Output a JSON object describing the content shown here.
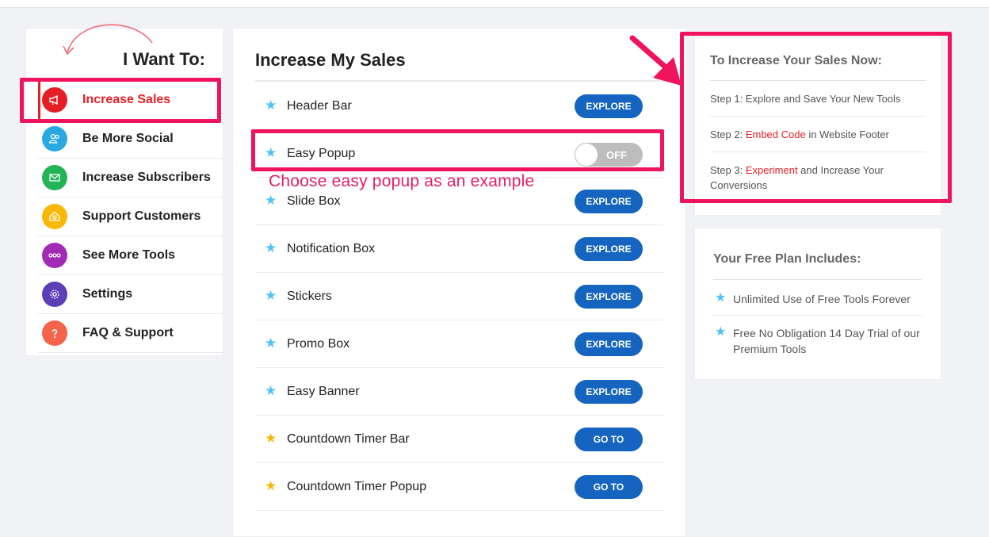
{
  "sidebar": {
    "title": "I Want To:",
    "items": [
      {
        "label": "Increase Sales",
        "icon": "megaphone-icon",
        "color": "#e51e25",
        "glyph": "✆"
      },
      {
        "label": "Be More Social",
        "icon": "users-icon",
        "color": "#29a9e1",
        "glyph": "☺"
      },
      {
        "label": "Increase Subscribers",
        "icon": "envelope-icon",
        "color": "#22b557",
        "glyph": "✉"
      },
      {
        "label": "Support Customers",
        "icon": "support-icon",
        "color": "#f9b708",
        "glyph": "⌂"
      },
      {
        "label": "See More Tools",
        "icon": "more-icon",
        "color": "#a12bb5",
        "glyph": "∞"
      },
      {
        "label": "Settings",
        "icon": "gear-icon",
        "color": "#5c3fb6",
        "glyph": "⚙"
      },
      {
        "label": "FAQ & Support",
        "icon": "question-icon",
        "color": "#f4634c",
        "glyph": "?"
      }
    ]
  },
  "main": {
    "title": "Increase My Sales",
    "annotation": "Choose easy popup as an example",
    "tools": [
      {
        "name": "Header Bar",
        "action": "EXPLORE",
        "star_color": "#4fc3f7"
      },
      {
        "name": "Easy Popup",
        "toggle": "OFF",
        "star_color": "#4fc3f7"
      },
      {
        "name": "Slide Box",
        "action": "EXPLORE",
        "star_color": "#4fc3f7"
      },
      {
        "name": "Notification Box",
        "action": "EXPLORE",
        "star_color": "#4fc3f7"
      },
      {
        "name": "Stickers",
        "action": "EXPLORE",
        "star_color": "#4fc3f7"
      },
      {
        "name": "Promo Box",
        "action": "EXPLORE",
        "star_color": "#4fc3f7"
      },
      {
        "name": "Easy Banner",
        "action": "EXPLORE",
        "star_color": "#4fc3f7"
      },
      {
        "name": "Countdown Timer Bar",
        "action": "GO TO",
        "star_color": "#f9b708"
      },
      {
        "name": "Countdown Timer Popup",
        "action": "GO TO",
        "star_color": "#f9b708"
      }
    ]
  },
  "steps_panel": {
    "title": "To Increase Your Sales Now:",
    "step1": {
      "text": "Step 1: Explore and Save Your New Tools"
    },
    "step2": {
      "prefix": "Step 2: ",
      "highlight": "Embed Code",
      "suffix": " in Website Footer"
    },
    "step3": {
      "prefix": "Step 3: ",
      "highlight": "Experiment",
      "suffix": " and Increase Your Conversions"
    }
  },
  "plan_panel": {
    "title": "Your Free Plan Includes:",
    "features": [
      "Unlimited Use of Free Tools Forever",
      "Free No Obligation 14 Day Trial of our Premium Tools"
    ]
  },
  "colors": {
    "accent_red": "#e51e25",
    "highlight_pink": "#f0145d",
    "button_blue": "#1565c0"
  }
}
